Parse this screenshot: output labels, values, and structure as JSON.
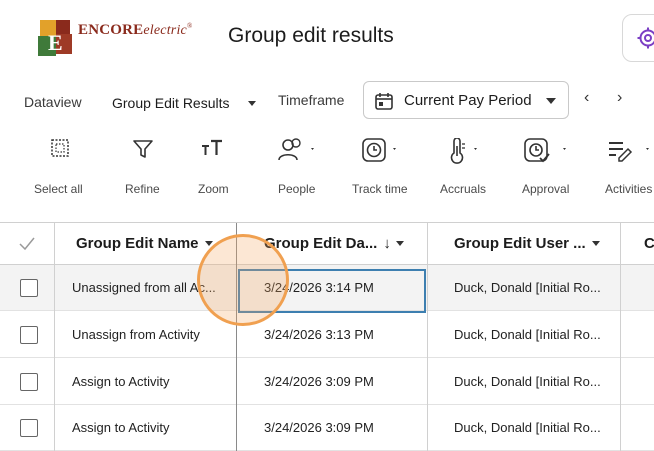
{
  "header": {
    "logo_text_bold": "ENCORE",
    "logo_text_light": "electric",
    "logo_tm": "®",
    "page_title": "Group edit results"
  },
  "filters": {
    "dataview_label": "Dataview",
    "dataview_value": "Group Edit Results",
    "timeframe_label": "Timeframe",
    "timeframe_value": "Current Pay Period",
    "prev_glyph": "‹",
    "next_glyph": "›"
  },
  "toolbar": [
    {
      "label": "Select all",
      "icon": "select-all-icon"
    },
    {
      "label": "Refine",
      "icon": "filter-icon"
    },
    {
      "label": "Zoom",
      "icon": "text-size-icon"
    },
    {
      "label": "People",
      "icon": "people-icon"
    },
    {
      "label": "Track time",
      "icon": "clock-icon"
    },
    {
      "label": "Accruals",
      "icon": "thermometer-icon"
    },
    {
      "label": "Approval",
      "icon": "approval-icon"
    },
    {
      "label": "Activities",
      "icon": "activities-icon"
    }
  ],
  "table": {
    "columns": [
      "Group Edit Name",
      "Group Edit Da...",
      "Group Edit User ...",
      "C"
    ],
    "rows": [
      {
        "name": "Unassigned from all Ac...",
        "date": "3/24/2026 3:14 PM",
        "user": "Duck, Donald [Initial Ro..."
      },
      {
        "name": "Unassign from Activity",
        "date": "3/24/2026 3:13 PM",
        "user": "Duck, Donald [Initial Ro..."
      },
      {
        "name": "Assign to Activity",
        "date": "3/24/2026 3:09 PM",
        "user": "Duck, Donald [Initial Ro..."
      },
      {
        "name": "Assign to Activity",
        "date": "3/24/2026 3:09 PM",
        "user": "Duck, Donald [Initial Ro..."
      }
    ]
  },
  "colors": {
    "accent_purple": "#7b3fc4",
    "focus_blue": "#3d7fb0",
    "click_orange": "#f0a050",
    "brand_red": "#8a2a1c"
  }
}
